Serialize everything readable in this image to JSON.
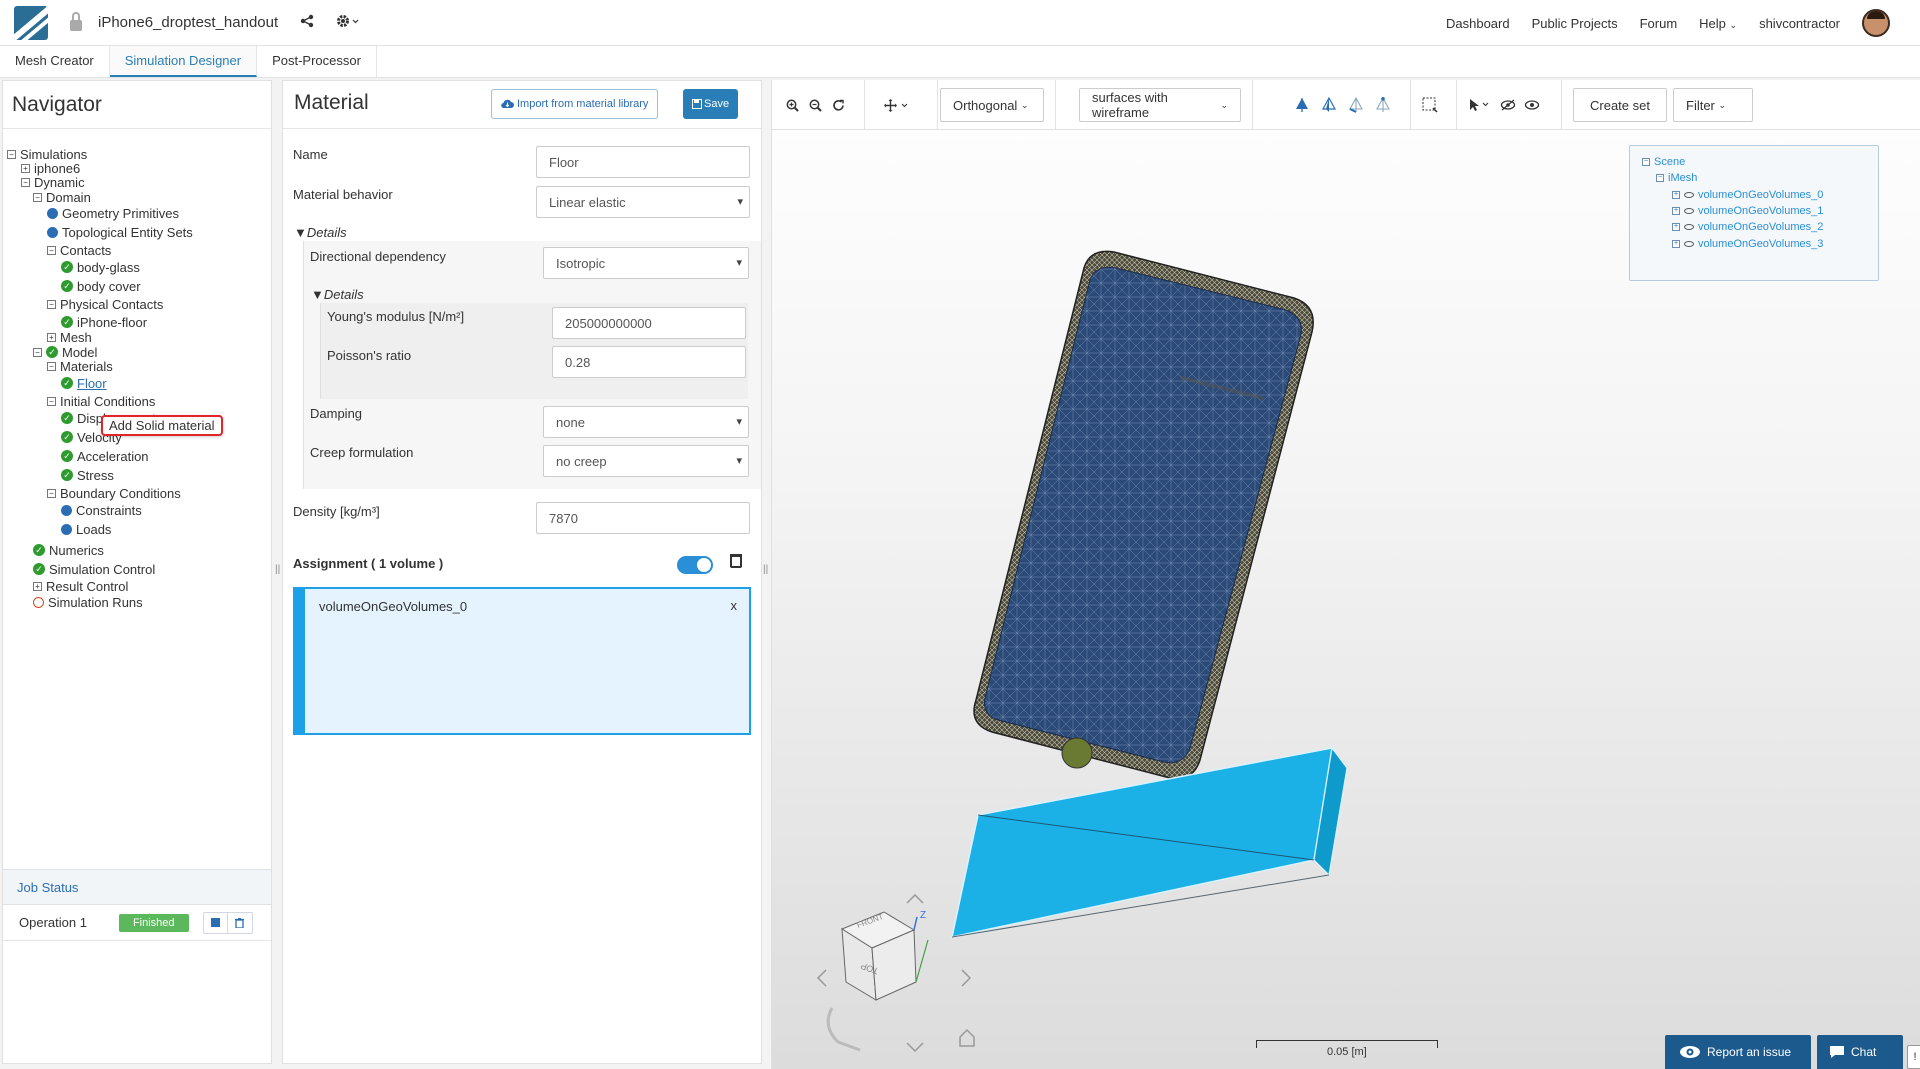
{
  "header": {
    "project_title": "iPhone6_droptest_handout",
    "nav": [
      "Dashboard",
      "Public Projects",
      "Forum",
      "Help",
      "shivcontractor"
    ]
  },
  "tabs": [
    {
      "label": "Mesh Creator",
      "active": false
    },
    {
      "label": "Simulation Designer",
      "active": true
    },
    {
      "label": "Post-Processor",
      "active": false
    }
  ],
  "navigator": {
    "title": "Navigator",
    "tree": [
      {
        "label": "Simulations",
        "depth": 0,
        "icon": "minus"
      },
      {
        "label": "iphone6",
        "depth": 1,
        "icon": "plus"
      },
      {
        "label": "Dynamic",
        "depth": 1,
        "icon": "minus"
      },
      {
        "label": "Domain",
        "depth": 2,
        "icon": "minus"
      },
      {
        "label": "Geometry Primitives",
        "depth": 3,
        "icon": "dot"
      },
      {
        "label": "Topological Entity Sets",
        "depth": 3,
        "icon": "dot"
      },
      {
        "label": "Contacts",
        "depth": 3,
        "icon": "minus"
      },
      {
        "label": "body-glass",
        "depth": 4,
        "icon": "check"
      },
      {
        "label": "body cover",
        "depth": 4,
        "icon": "check"
      },
      {
        "label": "Physical Contacts",
        "depth": 3,
        "icon": "minus"
      },
      {
        "label": "iPhone-floor",
        "depth": 4,
        "icon": "check"
      },
      {
        "label": "Mesh",
        "depth": 3,
        "icon": "plus"
      },
      {
        "label": "Model",
        "depth": 2,
        "icon": "minus-check"
      },
      {
        "label": "Materials",
        "depth": 3,
        "icon": "minus"
      },
      {
        "label": "Floor",
        "depth": 4,
        "icon": "check"
      },
      {
        "label": "Initial Conditions",
        "depth": 3,
        "icon": "minus"
      },
      {
        "label": "Displacement",
        "depth": 4,
        "icon": "check"
      },
      {
        "label": "Velocity",
        "depth": 4,
        "icon": "check"
      },
      {
        "label": "Acceleration",
        "depth": 4,
        "icon": "check"
      },
      {
        "label": "Stress",
        "depth": 4,
        "icon": "check"
      },
      {
        "label": "Boundary Conditions",
        "depth": 3,
        "icon": "minus"
      },
      {
        "label": "Constraints",
        "depth": 4,
        "icon": "dot"
      },
      {
        "label": "Loads",
        "depth": 4,
        "icon": "dot"
      },
      {
        "label": "Numerics",
        "depth": 2,
        "icon": "check"
      },
      {
        "label": "Simulation Control",
        "depth": 2,
        "icon": "check"
      },
      {
        "label": "Result Control",
        "depth": 2,
        "icon": "plus"
      },
      {
        "label": "Simulation Runs",
        "depth": 2,
        "icon": "ring"
      }
    ],
    "context_popup": "Add Solid material"
  },
  "job_status": {
    "title": "Job Status",
    "operation": "Operation 1",
    "status": "Finished"
  },
  "material": {
    "title": "Material",
    "import_label": "Import from material library",
    "save_label": "Save",
    "name_label": "Name",
    "name_value": "Floor",
    "behavior_label": "Material behavior",
    "behavior_value": "Linear elastic",
    "details_label": "Details",
    "directional_label": "Directional dependency",
    "directional_value": "Isotropic",
    "inner_details_label": "Details",
    "youngs_label": "Young's modulus [N/m²]",
    "youngs_value": "205000000000",
    "poisson_label": "Poisson's ratio",
    "poisson_value": "0.28",
    "damping_label": "Damping",
    "damping_value": "none",
    "creep_label": "Creep formulation",
    "creep_value": "no creep",
    "density_label": "Density [kg/m³]",
    "density_value": "7870",
    "assignment_label": "Assignment   ( 1 volume )",
    "assigned_item": "volumeOnGeoVolumes_0"
  },
  "viewer": {
    "projection": "Orthogonal",
    "render_mode": "surfaces with wireframe",
    "create_set": "Create set",
    "filter": "Filter",
    "scene_tree": {
      "root": "Scene",
      "mesh": "iMesh",
      "volumes": [
        "volumeOnGeoVolumes_0",
        "volumeOnGeoVolumes_1",
        "volumeOnGeoVolumes_2",
        "volumeOnGeoVolumes_3"
      ]
    },
    "scale_label": "0.05 [m]",
    "axis_z": "Z",
    "cube_front": "FRONT",
    "cube_top": "TOP",
    "report_label": "Report an issue",
    "chat_label": "Chat",
    "edge_label": "!"
  },
  "colors": {
    "accent": "#2a7eb8",
    "floor": "#1bb0e6",
    "phone_mesh": "#2c4a78",
    "finished": "#5cb85c"
  }
}
